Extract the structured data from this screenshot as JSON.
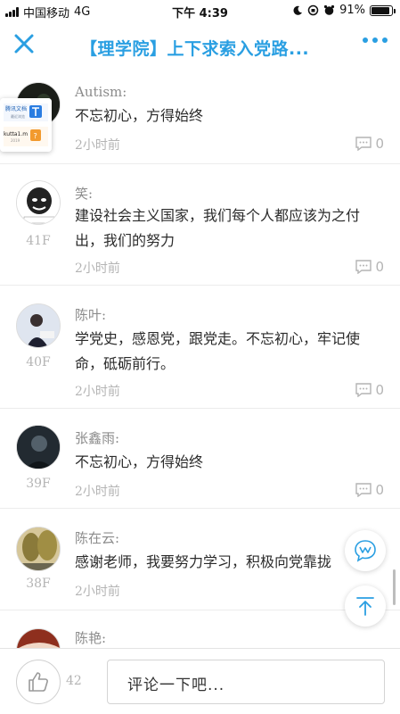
{
  "status_bar": {
    "carrier": "中国移动",
    "network": "4G",
    "time": "下午 4:39",
    "battery": "91%",
    "battery_level": 0.91
  },
  "nav": {
    "title": "【理学院】上下求索入党路..."
  },
  "comments": [
    {
      "name": "Autism:",
      "text": "不忘初心，方得始终",
      "time": "2小时前",
      "floor": "",
      "replies": "0"
    },
    {
      "name": "笑:",
      "text": "建设社会主义国家，我们每个人都应该为之付出，我们的努力",
      "time": "2小时前",
      "floor": "41F",
      "replies": "0"
    },
    {
      "name": "陈叶:",
      "text": "学党史，感恩党，跟党走。不忘初心，牢记使命，砥砺前行。",
      "time": "2小时前",
      "floor": "40F",
      "replies": "0"
    },
    {
      "name": "张鑫雨:",
      "text": "不忘初心，方得始终",
      "time": "2小时前",
      "floor": "39F",
      "replies": "0"
    },
    {
      "name": "陈在云:",
      "text": "感谢老师，我要努力学习，积极向党靠拢",
      "time": "2小时前",
      "floor": "38F",
      "replies": "0"
    },
    {
      "name": "陈艳:",
      "text": "",
      "time": "",
      "floor": "",
      "replies": ""
    }
  ],
  "popup": {
    "line1": "腾讯文档",
    "line2": "最近浏览",
    "line3": "kutta1.m",
    "line4": "2019"
  },
  "bottom_bar": {
    "like_count": "42",
    "comment_placeholder": "评论一下吧..."
  },
  "colors": {
    "accent": "#2a9fe2",
    "muted": "#b4b4b4"
  }
}
